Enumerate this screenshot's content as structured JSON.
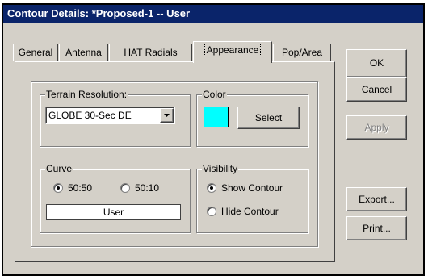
{
  "window": {
    "title": "Contour Details: *Proposed-1 -- User"
  },
  "tabs": [
    {
      "label": "General"
    },
    {
      "label": "Antenna"
    },
    {
      "label": "HAT Radials"
    },
    {
      "label": "Appearance",
      "active": true
    },
    {
      "label": "Pop/Area"
    }
  ],
  "terrain": {
    "legend": "Terrain Resolution:",
    "selected": "GLOBE 30-Sec DE"
  },
  "color": {
    "legend": "Color",
    "swatch": "#00ffff",
    "select_label": "Select"
  },
  "curve": {
    "legend": "Curve",
    "options": [
      {
        "label": "50:50",
        "checked": true
      },
      {
        "label": "50:10",
        "checked": false
      }
    ],
    "value": "User"
  },
  "visibility": {
    "legend": "Visibility",
    "options": [
      {
        "label": "Show Contour",
        "checked": true
      },
      {
        "label": "Hide Contour",
        "checked": false
      }
    ]
  },
  "buttons": {
    "ok": "OK",
    "cancel": "Cancel",
    "apply": "Apply",
    "export": "Export...",
    "print": "Print..."
  },
  "colors": {
    "titlebar": "#0a246a",
    "face": "#d4d0c8"
  }
}
